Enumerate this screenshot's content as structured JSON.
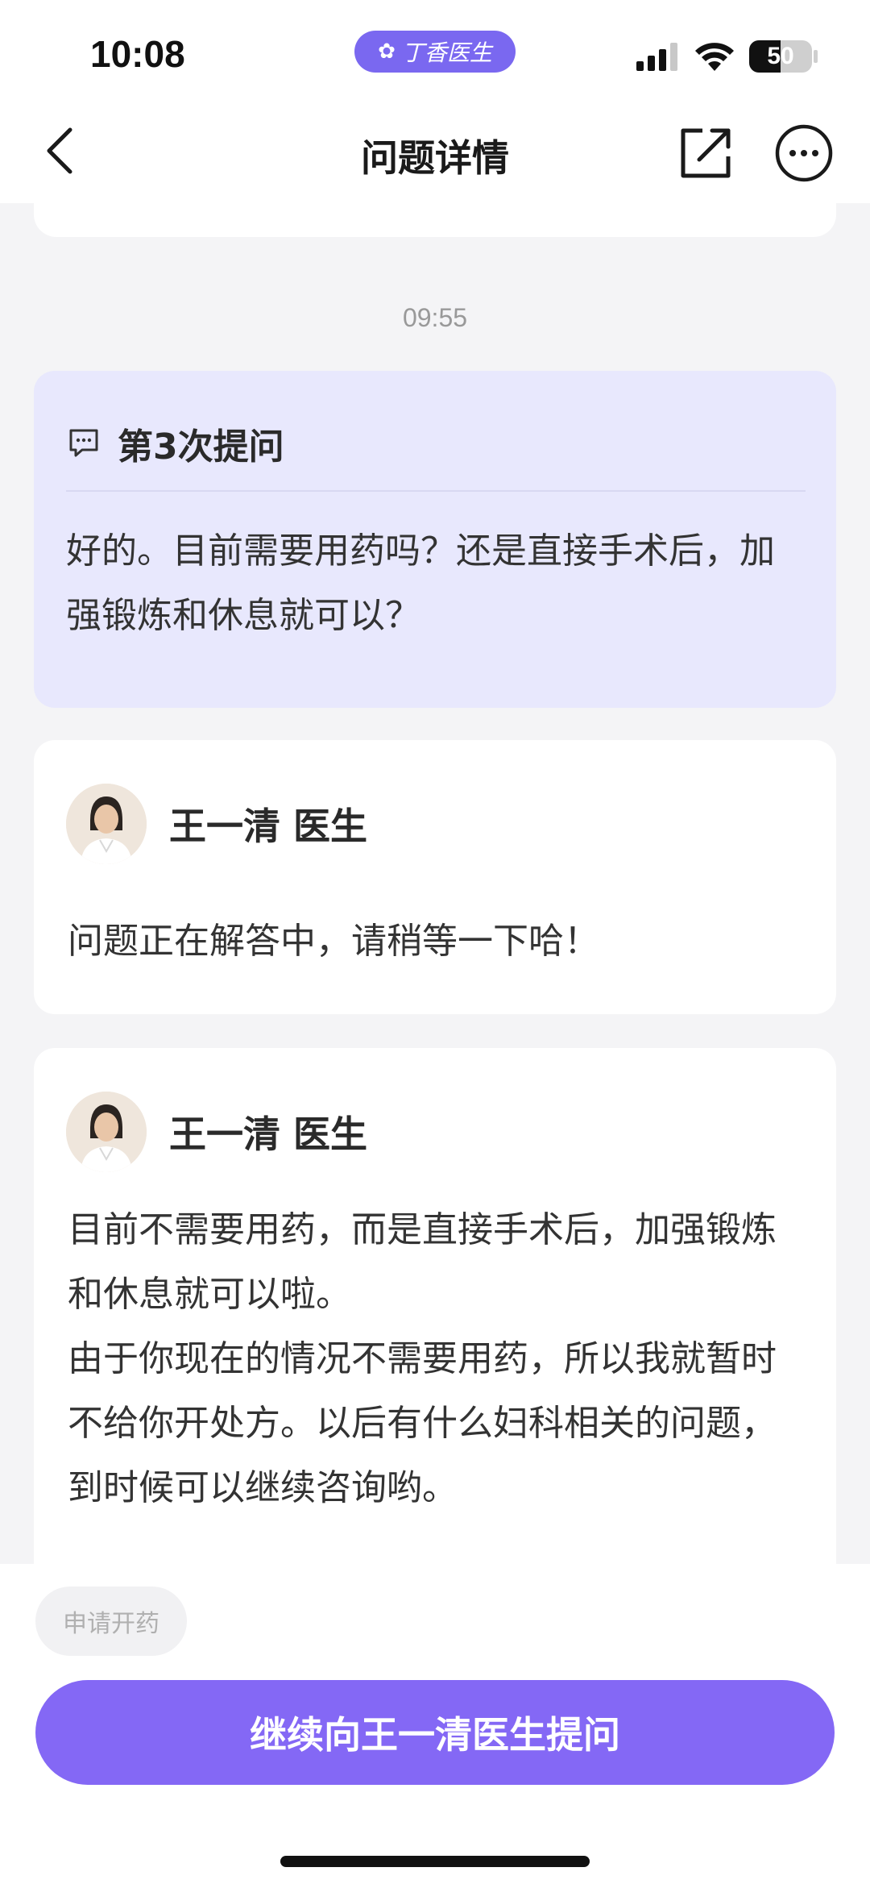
{
  "status_bar": {
    "time": "10:08",
    "app_pill": "丁香医生",
    "battery": "50",
    "icons": [
      "cellular-signal-icon",
      "wifi-icon",
      "battery-icon"
    ]
  },
  "navbar": {
    "title": "问题详情",
    "icons": [
      "back-chevron-icon",
      "share-icon",
      "more-icon"
    ]
  },
  "conversation": {
    "timestamp": "09:55",
    "question": {
      "title": "第3次提问",
      "text": "好的。目前需要用药吗？还是直接手术后，加强锻炼和休息就可以？"
    },
    "answers": [
      {
        "doctor": "王一清 医生",
        "paragraphs": [
          "问题正在解答中，请稍等一下哈！"
        ]
      },
      {
        "doctor": "王一清 医生",
        "paragraphs": [
          "目前不需要用药，而是直接手术后，加强锻炼和休息就可以啦。",
          "由于你现在的情况不需要用药，所以我就暂时不给你开处方。以后有什么妇科相关的问题，到时候可以继续咨询哟。"
        ]
      }
    ]
  },
  "bottom": {
    "chip_label": "申请开药",
    "cta_label": "继续向王一清医生提问"
  },
  "colors": {
    "accent": "#8468f5",
    "question_bg": "#e8e8fd",
    "page_bg": "#f4f4f6"
  }
}
